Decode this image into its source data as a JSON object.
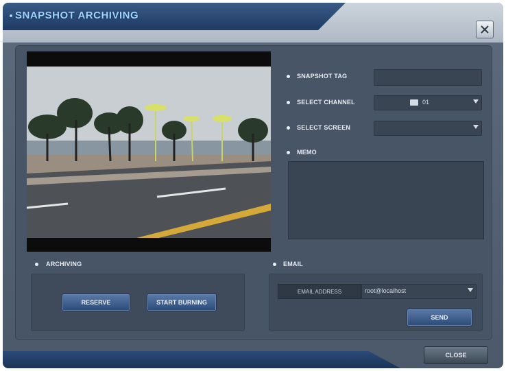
{
  "window": {
    "title": "SNAPSHOT ARCHIVING"
  },
  "form": {
    "snapshot_tag_label": "SNAPSHOT TAG",
    "snapshot_tag_value": "",
    "select_channel_label": "SELECT CHANNEL",
    "select_channel_value": "01",
    "select_screen_label": "SELECT SCREEN",
    "select_screen_value": "",
    "memo_label": "MEMO",
    "memo_value": ""
  },
  "archiving": {
    "label": "ARCHIVING",
    "reserve_button": "RESERVE",
    "start_burning_button": "START BURNING"
  },
  "email": {
    "label": "EMAIL",
    "address_label": "EMAIL ADDRESS",
    "address_value": "root@localhost",
    "send_button": "SEND"
  },
  "footer": {
    "close_button": "CLOSE"
  }
}
